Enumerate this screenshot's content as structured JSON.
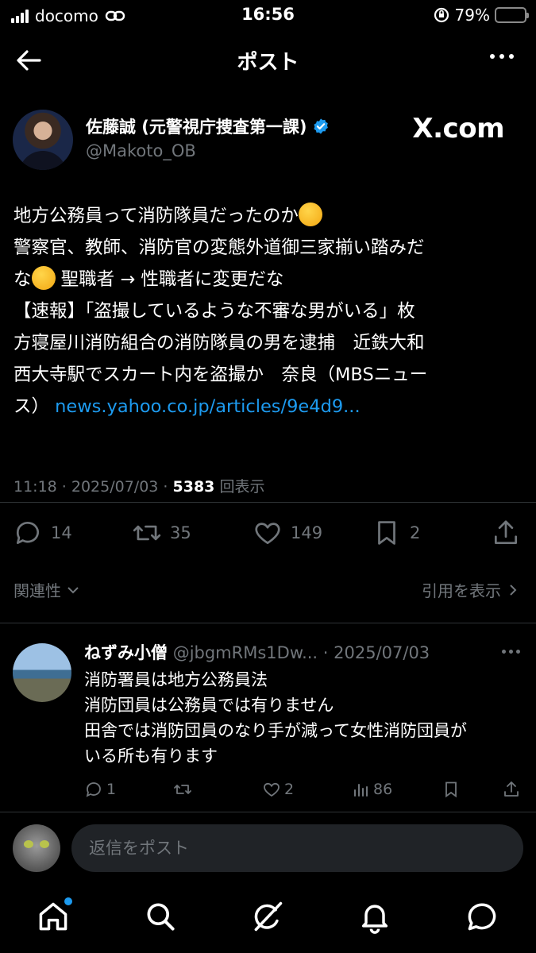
{
  "status_bar": {
    "carrier": "docomo",
    "time": "16:56",
    "battery": "79%",
    "battery_level": 0.79
  },
  "header": {
    "title": "ポスト"
  },
  "post": {
    "author_name": "佐藤誠 (元警視庁捜査第一課)",
    "author_handle": "@Makoto_OB",
    "watermark": "X.com",
    "lines": {
      "l1": "地方公務員って消防隊員だったのか",
      "l2": "警察官、教師、消防官の変態外道御三家揃い踏みだ",
      "l3a": "な",
      "l3b": "聖職者 → 性職者に変更だな",
      "l4": "【速報】「盗撮しているような不審な男がいる」枚",
      "l5": "方寝屋川消防組合の消防隊員の男を逮捕　近鉄大和",
      "l6": "西大寺駅でスカート内を盗撮か　奈良（MBSニュー",
      "l7": "ス）",
      "link": "news.yahoo.co.jp/articles/9e4d9..."
    },
    "meta_time": "11:18 · 2025/07/03 · ",
    "views": "5383",
    "views_label": "回表示",
    "replies": "14",
    "reposts": "35",
    "likes": "149",
    "bookmarks": "2"
  },
  "related_label": "関連性",
  "quotes_label": "引用を表示",
  "reply": {
    "name": "ねずみ小僧",
    "handle": "@jbgmRMs1Dw...",
    "date": " · 2025/07/03",
    "lines": [
      "消防署員は地方公務員法",
      "消防団員は公務員では有りません",
      "田舎では消防団員のなり手が減って女性消防団員が",
      "いる所も有ります"
    ],
    "replies": "1",
    "likes": "2",
    "views": "86"
  },
  "composer": {
    "placeholder": "返信をポスト"
  },
  "icons": {
    "accent": "#1d9bf0",
    "nav": [
      "home-icon",
      "search-icon",
      "grok-icon",
      "notifications-icon",
      "messages-icon"
    ]
  }
}
